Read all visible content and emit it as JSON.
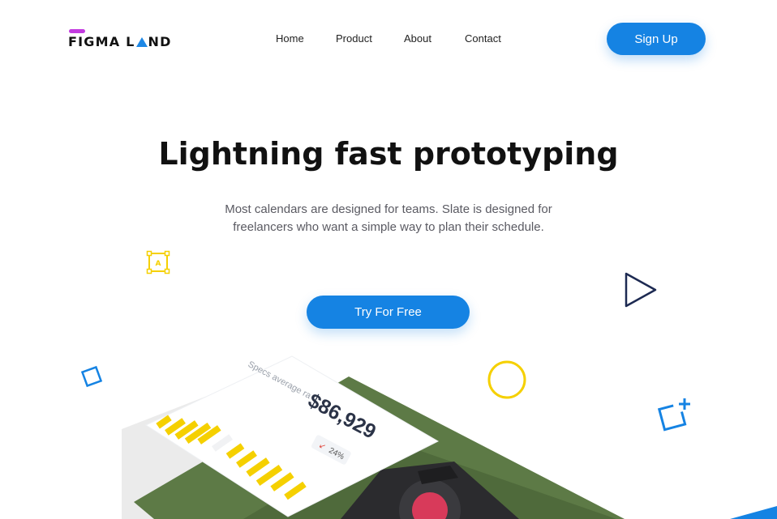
{
  "header": {
    "logo_text_left": "FIGMA L",
    "logo_text_right": "ND",
    "nav": [
      "Home",
      "Product",
      "About",
      "Contact"
    ],
    "signup_label": "Sign Up"
  },
  "hero": {
    "title": "Lightning fast prototyping",
    "subtitle_line1": "Most calendars are designed for teams. Slate is designed for",
    "subtitle_line2": "freelancers who want a simple way to plan their schedule.",
    "cta_label": "Try For Free"
  },
  "card": {
    "label": "Specs average ra",
    "value": "$86,929",
    "change": "24%"
  },
  "colors": {
    "primary": "#1583e3",
    "accent_yellow": "#f5d000",
    "logo_pink": "#c33be0",
    "dark_navy": "#1d2a52",
    "scene_green": "#5d7a46"
  }
}
